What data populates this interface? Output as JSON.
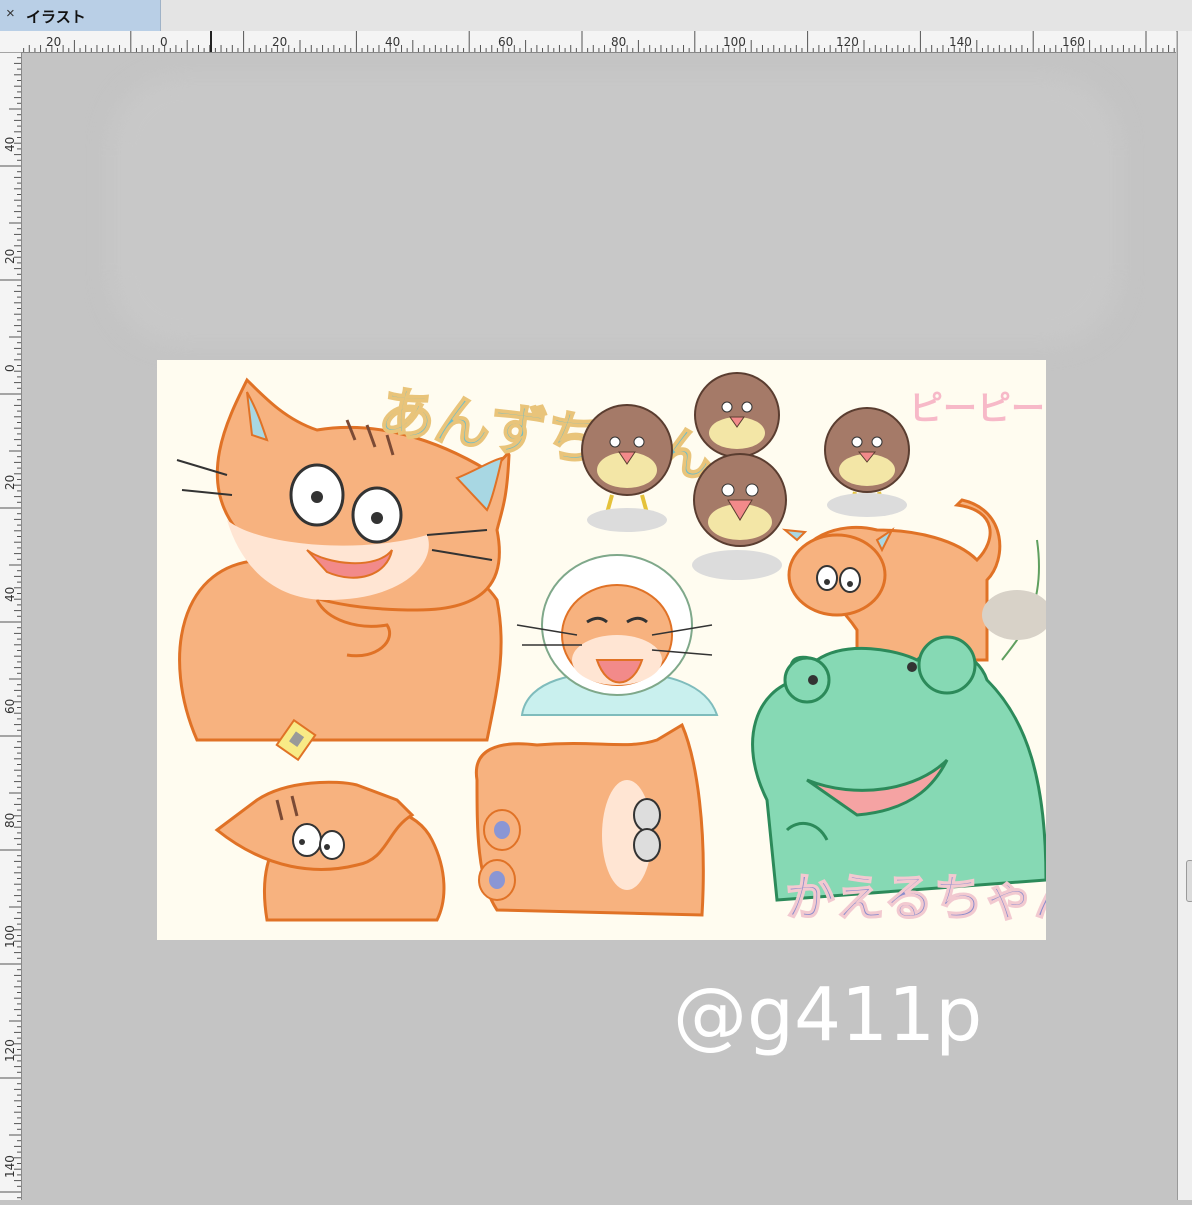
{
  "tab": {
    "title": "イラスト",
    "close_symbol": "×"
  },
  "rulers": {
    "horizontal_labels": [
      "20",
      "0",
      "20",
      "40",
      "60",
      "80",
      "100",
      "120",
      "140",
      "160"
    ],
    "vertical_labels": [
      "40",
      "20",
      "0",
      "20",
      "40",
      "60",
      "80",
      "100",
      "120",
      "140"
    ]
  },
  "illustration": {
    "title_anzu": "あんずちゃん",
    "title_piipii": "ピーピーちゃん",
    "title_kaeru": "かえるちゃん",
    "colors": {
      "cat_fill": "#f7b27f",
      "cat_line": "#e07226",
      "frog_fill": "#86d9b4",
      "frog_line": "#2c8a5a",
      "bird_fill": "#a57a68",
      "bird_belly": "#f3e6a6",
      "anzu_text": "#6bbcc9",
      "piipii_text": "#f7b9c8",
      "kaeru_text": "#8a8ccc"
    }
  },
  "signature": "@g411p",
  "icons": [
    "close-icon"
  ]
}
